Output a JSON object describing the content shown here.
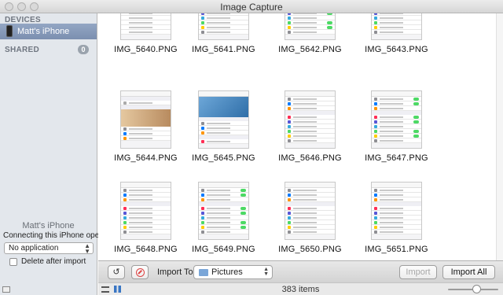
{
  "window": {
    "title": "Image Capture"
  },
  "sidebar": {
    "devices_header": "DEVICES",
    "device_name": "Matt's iPhone",
    "shared_header": "SHARED",
    "shared_count": "0",
    "bottom": {
      "device_name": "Matt's iPhone",
      "connecting_label": "Connecting this iPhone opens:",
      "app_select_value": "No application",
      "delete_after_label": "Delete after import",
      "delete_after_checked": false
    }
  },
  "grid": {
    "items": [
      {
        "name": "IMG_5640.PNG",
        "kind": "list"
      },
      {
        "name": "IMG_5641.PNG",
        "kind": "settings"
      },
      {
        "name": "IMG_5642.PNG",
        "kind": "toggles"
      },
      {
        "name": "IMG_5643.PNG",
        "kind": "settings"
      },
      {
        "name": "IMG_5644.PNG",
        "kind": "photo"
      },
      {
        "name": "IMG_5645.PNG",
        "kind": "wallpaper"
      },
      {
        "name": "IMG_5646.PNG",
        "kind": "settings"
      },
      {
        "name": "IMG_5647.PNG",
        "kind": "toggles"
      },
      {
        "name": "IMG_5648.PNG",
        "kind": "settings"
      },
      {
        "name": "IMG_5649.PNG",
        "kind": "toggles"
      },
      {
        "name": "IMG_5650.PNG",
        "kind": "settings"
      },
      {
        "name": "IMG_5651.PNG",
        "kind": "settings"
      }
    ]
  },
  "toolbar": {
    "rotate_icon": "rotate-left-icon",
    "delete_icon": "delete-icon",
    "import_to_label": "Import To:",
    "destination_value": "Pictures",
    "import_label": "Import",
    "import_all_label": "Import All"
  },
  "status": {
    "item_count": "383 items",
    "zoom_level": 0.56
  },
  "colors": {
    "sidebar_bg": "#e3e7ec",
    "selection": "#7b8fb0",
    "toggle_on": "#4cd964"
  }
}
